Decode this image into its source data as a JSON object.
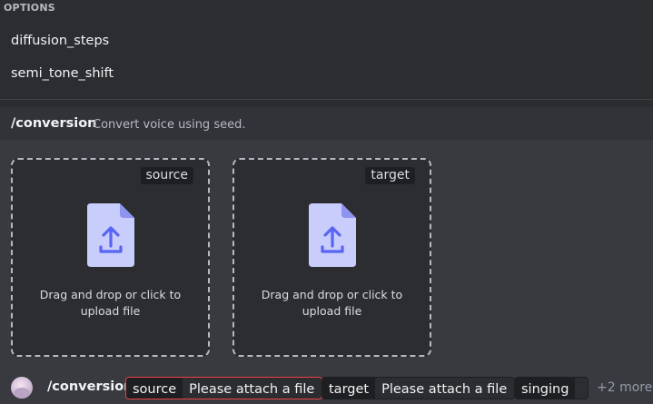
{
  "options": {
    "header": "OPTIONS",
    "items": [
      {
        "label": "diffusion_steps"
      },
      {
        "label": "semi_tone_shift"
      }
    ]
  },
  "command": {
    "name": "/conversion",
    "description": "Convert voice using seed."
  },
  "uploads": [
    {
      "tag": "source",
      "prompt": "Drag and drop or click to upload file",
      "icon": "file-upload-icon"
    },
    {
      "tag": "target",
      "prompt": "Drag and drop or click to upload file",
      "icon": "file-upload-icon"
    }
  ],
  "input_bar": {
    "command": "/conversion",
    "params": [
      {
        "key": "source",
        "value": "Please attach a file",
        "status": "error"
      },
      {
        "key": "target",
        "value": "Please attach a file",
        "status": "normal"
      },
      {
        "key": "singing",
        "value": "",
        "status": "normal"
      }
    ],
    "more": "+2 more"
  },
  "colors": {
    "background": "#2b2d31",
    "accent": "#5865f2",
    "error": "#f23f43",
    "file_icon": "#c9cdfb"
  }
}
